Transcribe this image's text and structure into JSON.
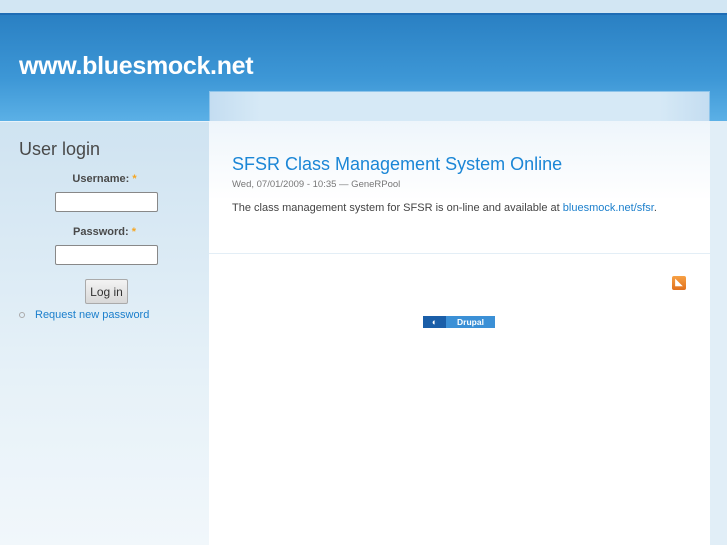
{
  "site": {
    "name": "www.bluesmock.net"
  },
  "login": {
    "title": "User login",
    "username_label": "Username:",
    "password_label": "Password:",
    "required": "*",
    "username_value": "",
    "password_value": "",
    "submit": "Log in",
    "request_password": "Request new password"
  },
  "node": {
    "title": "SFSR Class Management System Online",
    "meta": "Wed, 07/01/2009 - 10:35 — GeneRPool",
    "body_text": "The class management system for SFSR is on-line and available at ",
    "link": "bluesmock.net/sfsr",
    "body_end": "."
  },
  "footer": {
    "powered_by": "Drupal"
  }
}
